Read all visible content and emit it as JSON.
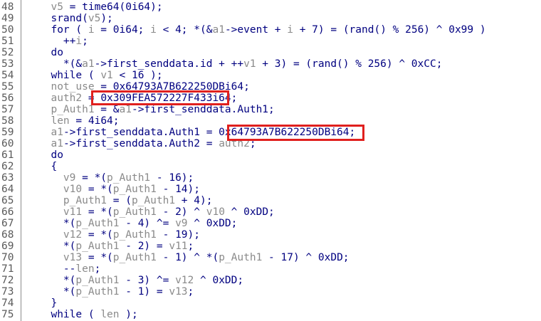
{
  "colors": {
    "code_text": "#000080",
    "variable": "#8a8a8a",
    "line_number": "#5a5a5a",
    "highlight_box": "#e0201e"
  },
  "lines": [
    {
      "num": "48",
      "segs": [
        {
          "t": "  ",
          "v": false
        },
        {
          "t": "v5",
          "v": true
        },
        {
          "t": " = time64(0i64);",
          "v": false
        }
      ]
    },
    {
      "num": "49",
      "segs": [
        {
          "t": "  srand(",
          "v": false
        },
        {
          "t": "v5",
          "v": true
        },
        {
          "t": ");",
          "v": false
        }
      ]
    },
    {
      "num": "50",
      "segs": [
        {
          "t": "  for ( ",
          "v": false
        },
        {
          "t": "i",
          "v": true
        },
        {
          "t": " = 0i64; ",
          "v": false
        },
        {
          "t": "i",
          "v": true
        },
        {
          "t": " < 4; *(&",
          "v": false
        },
        {
          "t": "a1",
          "v": true
        },
        {
          "t": "->event + ",
          "v": false
        },
        {
          "t": "i",
          "v": true
        },
        {
          "t": " + 7) = (rand() % 256) ^ 0x99 )",
          "v": false
        }
      ]
    },
    {
      "num": "51",
      "segs": [
        {
          "t": "    ++",
          "v": false
        },
        {
          "t": "i",
          "v": true
        },
        {
          "t": ";",
          "v": false
        }
      ]
    },
    {
      "num": "52",
      "segs": [
        {
          "t": "  do",
          "v": false
        }
      ]
    },
    {
      "num": "53",
      "segs": [
        {
          "t": "    *(&",
          "v": false
        },
        {
          "t": "a1",
          "v": true
        },
        {
          "t": "->first_senddata.id + ++",
          "v": false
        },
        {
          "t": "v1",
          "v": true
        },
        {
          "t": " + 3) = (rand() % 256) ^ 0xCC;",
          "v": false
        }
      ]
    },
    {
      "num": "54",
      "segs": [
        {
          "t": "  while ( ",
          "v": false
        },
        {
          "t": "v1",
          "v": true
        },
        {
          "t": " < 16 );",
          "v": false
        }
      ]
    },
    {
      "num": "55",
      "segs": [
        {
          "t": "  ",
          "v": false
        },
        {
          "t": "not_use",
          "v": true
        },
        {
          "t": " = 0x64793A7B622250DBi64;",
          "v": false
        }
      ]
    },
    {
      "num": "56",
      "segs": [
        {
          "t": "  ",
          "v": false
        },
        {
          "t": "auth2",
          "v": true
        },
        {
          "t": " = 0x309FEA572227F433i64;",
          "v": false
        }
      ]
    },
    {
      "num": "57",
      "segs": [
        {
          "t": "  ",
          "v": false
        },
        {
          "t": "p_Auth1",
          "v": true
        },
        {
          "t": " = &",
          "v": false
        },
        {
          "t": "a1",
          "v": true
        },
        {
          "t": "->first_senddata.Auth1;",
          "v": false
        }
      ]
    },
    {
      "num": "58",
      "segs": [
        {
          "t": "  ",
          "v": false
        },
        {
          "t": "len",
          "v": true
        },
        {
          "t": " = 4i64;",
          "v": false
        }
      ]
    },
    {
      "num": "59",
      "segs": [
        {
          "t": "  ",
          "v": false
        },
        {
          "t": "a1",
          "v": true
        },
        {
          "t": "->first_senddata.Auth1 = 0x64793A7B622250DBi64;",
          "v": false
        }
      ]
    },
    {
      "num": "60",
      "segs": [
        {
          "t": "  ",
          "v": false
        },
        {
          "t": "a1",
          "v": true
        },
        {
          "t": "->first_senddata.Auth2 = ",
          "v": false
        },
        {
          "t": "auth2",
          "v": true
        },
        {
          "t": ";",
          "v": false
        }
      ]
    },
    {
      "num": "61",
      "segs": [
        {
          "t": "  do",
          "v": false
        }
      ]
    },
    {
      "num": "62",
      "segs": [
        {
          "t": "  {",
          "v": false
        }
      ]
    },
    {
      "num": "63",
      "segs": [
        {
          "t": "    ",
          "v": false
        },
        {
          "t": "v9",
          "v": true
        },
        {
          "t": " = *(",
          "v": false
        },
        {
          "t": "p_Auth1",
          "v": true
        },
        {
          "t": " - 16);",
          "v": false
        }
      ]
    },
    {
      "num": "64",
      "segs": [
        {
          "t": "    ",
          "v": false
        },
        {
          "t": "v10",
          "v": true
        },
        {
          "t": " = *(",
          "v": false
        },
        {
          "t": "p_Auth1",
          "v": true
        },
        {
          "t": " - 14);",
          "v": false
        }
      ]
    },
    {
      "num": "65",
      "segs": [
        {
          "t": "    ",
          "v": false
        },
        {
          "t": "p_Auth1",
          "v": true
        },
        {
          "t": " = (",
          "v": false
        },
        {
          "t": "p_Auth1",
          "v": true
        },
        {
          "t": " + 4);",
          "v": false
        }
      ]
    },
    {
      "num": "66",
      "segs": [
        {
          "t": "    ",
          "v": false
        },
        {
          "t": "v11",
          "v": true
        },
        {
          "t": " = *(",
          "v": false
        },
        {
          "t": "p_Auth1",
          "v": true
        },
        {
          "t": " - 2) ^ ",
          "v": false
        },
        {
          "t": "v10",
          "v": true
        },
        {
          "t": " ^ 0xDD;",
          "v": false
        }
      ]
    },
    {
      "num": "67",
      "segs": [
        {
          "t": "    *(",
          "v": false
        },
        {
          "t": "p_Auth1",
          "v": true
        },
        {
          "t": " - 4) ^= ",
          "v": false
        },
        {
          "t": "v9",
          "v": true
        },
        {
          "t": " ^ 0xDD;",
          "v": false
        }
      ]
    },
    {
      "num": "68",
      "segs": [
        {
          "t": "    ",
          "v": false
        },
        {
          "t": "v12",
          "v": true
        },
        {
          "t": " = *(",
          "v": false
        },
        {
          "t": "p_Auth1",
          "v": true
        },
        {
          "t": " - 19);",
          "v": false
        }
      ]
    },
    {
      "num": "69",
      "segs": [
        {
          "t": "    *(",
          "v": false
        },
        {
          "t": "p_Auth1",
          "v": true
        },
        {
          "t": " - 2) = ",
          "v": false
        },
        {
          "t": "v11",
          "v": true
        },
        {
          "t": ";",
          "v": false
        }
      ]
    },
    {
      "num": "70",
      "segs": [
        {
          "t": "    ",
          "v": false
        },
        {
          "t": "v13",
          "v": true
        },
        {
          "t": " = *(",
          "v": false
        },
        {
          "t": "p_Auth1",
          "v": true
        },
        {
          "t": " - 1) ^ *(",
          "v": false
        },
        {
          "t": "p_Auth1",
          "v": true
        },
        {
          "t": " - 17) ^ 0xDD;",
          "v": false
        }
      ]
    },
    {
      "num": "71",
      "segs": [
        {
          "t": "    --",
          "v": false
        },
        {
          "t": "len",
          "v": true
        },
        {
          "t": ";",
          "v": false
        }
      ]
    },
    {
      "num": "72",
      "segs": [
        {
          "t": "    *(",
          "v": false
        },
        {
          "t": "p_Auth1",
          "v": true
        },
        {
          "t": " - 3) ^= ",
          "v": false
        },
        {
          "t": "v12",
          "v": true
        },
        {
          "t": " ^ 0xDD;",
          "v": false
        }
      ]
    },
    {
      "num": "73",
      "segs": [
        {
          "t": "    *(",
          "v": false
        },
        {
          "t": "p_Auth1",
          "v": true
        },
        {
          "t": " - 1) = ",
          "v": false
        },
        {
          "t": "v13",
          "v": true
        },
        {
          "t": ";",
          "v": false
        }
      ]
    },
    {
      "num": "74",
      "segs": [
        {
          "t": "  }",
          "v": false
        }
      ]
    },
    {
      "num": "75",
      "segs": [
        {
          "t": "  while ( ",
          "v": false
        },
        {
          "t": "len",
          "v": true
        },
        {
          "t": " );",
          "v": false
        }
      ]
    }
  ]
}
